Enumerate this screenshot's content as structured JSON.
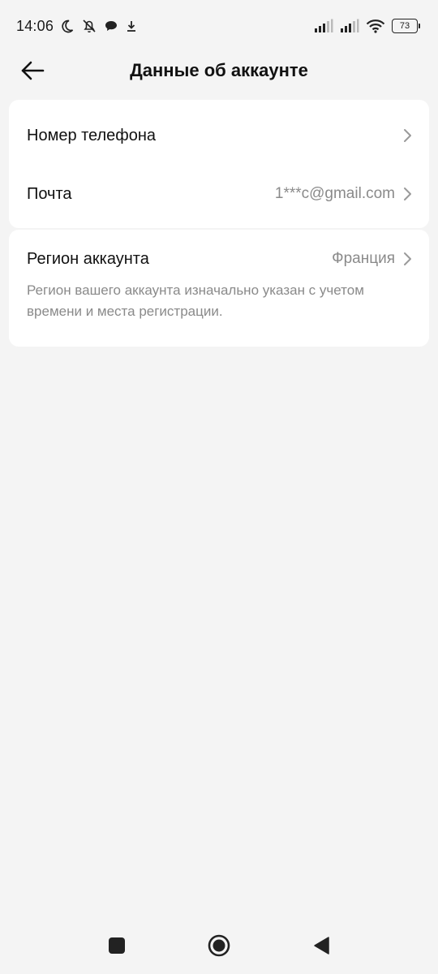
{
  "status_bar": {
    "time": "14:06",
    "battery": "73"
  },
  "header": {
    "title": "Данные об аккаунте"
  },
  "account_rows": [
    {
      "label": "Номер телефона",
      "value": ""
    },
    {
      "label": "Почта",
      "value": "1***c@gmail.com"
    }
  ],
  "region": {
    "label": "Регион аккаунта",
    "value": "Франция",
    "description": "Регион вашего аккаунта изначально указан с учетом времени и места регистрации."
  },
  "colors": {
    "background": "#f4f4f4",
    "card": "#ffffff",
    "secondary_text": "#8a8a8a"
  }
}
